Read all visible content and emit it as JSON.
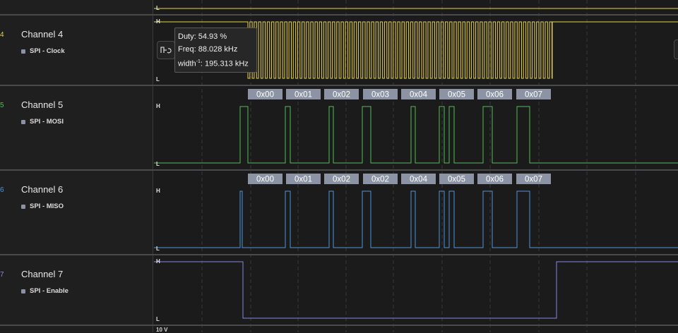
{
  "colors": {
    "ch4": "#e8d14a",
    "ch5": "#4fbf4f",
    "ch6": "#4a95e0",
    "ch7": "#8a86e0",
    "bubble": "#8b93a4"
  },
  "channels": [
    {
      "num": "4",
      "name": "Channel 4",
      "analyzer": "SPI - Clock"
    },
    {
      "num": "5",
      "name": "Channel 5",
      "analyzer": "SPI - MOSI"
    },
    {
      "num": "6",
      "name": "Channel 6",
      "analyzer": "SPI - MISO"
    },
    {
      "num": "7",
      "name": "Channel 7",
      "analyzer": "SPI - Enable"
    }
  ],
  "levels": {
    "high": "H",
    "low": "L"
  },
  "mosi_bytes": [
    "0x00",
    "0x01",
    "0x02",
    "0x03",
    "0x04",
    "0x05",
    "0x06",
    "0x07"
  ],
  "miso_bytes": [
    "0x00",
    "0x01",
    "0x02",
    "0x02",
    "0x04",
    "0x05",
    "0x06",
    "0x07"
  ],
  "tooltip": {
    "duty": "Duty: 54.93 %",
    "freq": "Freq: 88.028 kHz",
    "width_prefix": "width",
    "width_sup": "-1",
    "width_value": ": 195.313 kHz"
  },
  "icons": {
    "measure": "measure-icon"
  },
  "bottom_label": "10 V"
}
